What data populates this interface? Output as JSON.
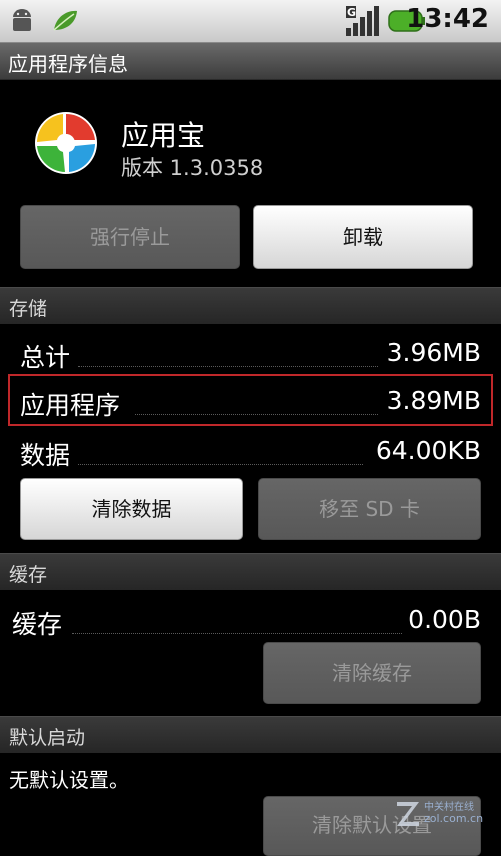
{
  "status_bar": {
    "time": "13:42",
    "network": "G",
    "icons": [
      "android-icon",
      "leaf-icon",
      "signal-icon",
      "battery-icon"
    ]
  },
  "title_bar": {
    "title": "应用程序信息"
  },
  "app": {
    "name": "应用宝",
    "version": "版本 1.3.0358",
    "icon": "app-logo-icon"
  },
  "buttons": {
    "force_stop": "强行停止",
    "uninstall": "卸载",
    "clear_data": "清除数据",
    "move_to_sd": "移至 SD 卡",
    "clear_cache": "清除缓存",
    "clear_defaults": "清除默认设置"
  },
  "storage": {
    "header": "存储",
    "rows": [
      {
        "label": "总计",
        "value": "3.96MB"
      },
      {
        "label": "应用程序",
        "value": "3.89MB"
      },
      {
        "label": "数据",
        "value": "64.00KB"
      }
    ]
  },
  "cache": {
    "header": "缓存",
    "rows": [
      {
        "label": "缓存",
        "value": "0.00B"
      }
    ]
  },
  "launch_default": {
    "header": "默认启动",
    "text": "无默认设置。"
  },
  "watermark": {
    "site": "zol.com.cn",
    "site_cn": "中关村在线"
  },
  "colors": {
    "highlight": "#c0282a",
    "status_bar": "#e0e0e0",
    "battery": "#4caf28"
  }
}
